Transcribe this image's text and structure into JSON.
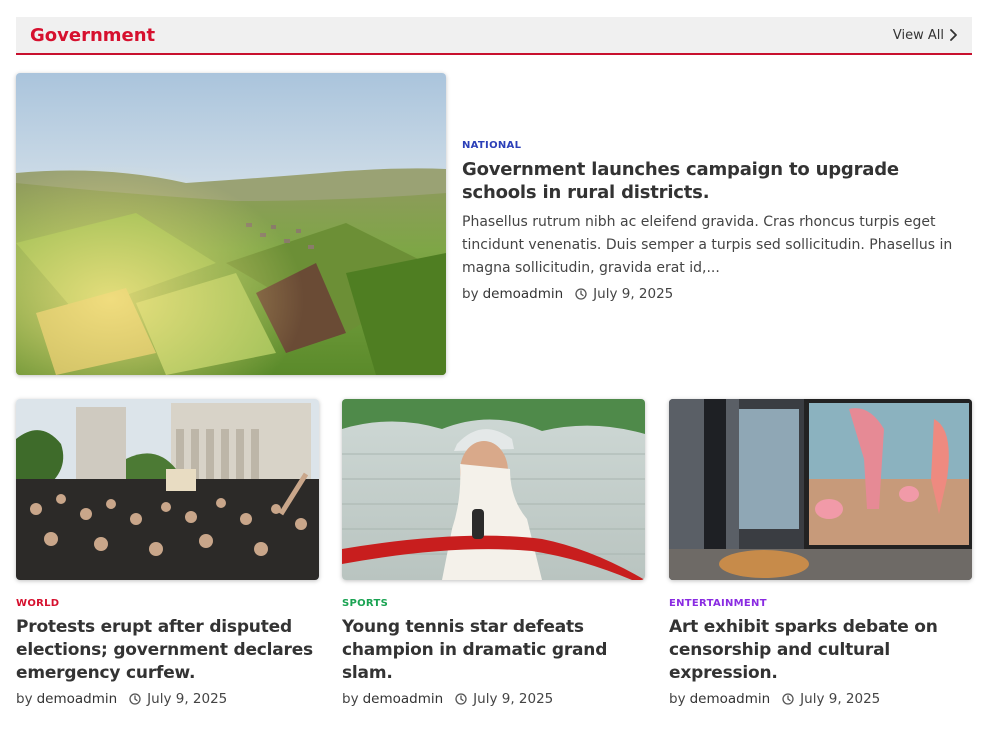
{
  "section": {
    "title": "Government",
    "view_all": "View All"
  },
  "featured": {
    "category": "NATIONAL",
    "category_color": "#2b3fb8",
    "headline": "Government launches campaign to upgrade schools in rural districts.",
    "excerpt": "Phasellus rutrum nibh ac eleifend gravida. Cras rhoncus turpis eget tincidunt venenatis. Duis semper a turpis sed sollicitudin. Phasellus in magna sollicitudin, gravida erat id,...",
    "by": "by",
    "author": "demoadmin",
    "date": "July 9, 2025"
  },
  "cards": [
    {
      "category": "WORLD",
      "category_color": "#d6102e",
      "headline": "Protests erupt after disputed elections; government declares emergency curfew.",
      "by": "by",
      "author": "demoadmin",
      "date": "July 9, 2025"
    },
    {
      "category": "SPORTS",
      "category_color": "#1aa352",
      "headline": "Young tennis star defeats champion in dramatic grand slam.",
      "by": "by",
      "author": "demoadmin",
      "date": "July 9, 2025"
    },
    {
      "category": "ENTERTAINMENT",
      "category_color": "#8a2be2",
      "headline": "Art exhibit sparks debate on censorship and cultural expression.",
      "by": "by",
      "author": "demoadmin",
      "date": "July 9, 2025"
    }
  ],
  "colors": {
    "accent": "#c8102e",
    "header_bg": "#f0f0f0"
  }
}
